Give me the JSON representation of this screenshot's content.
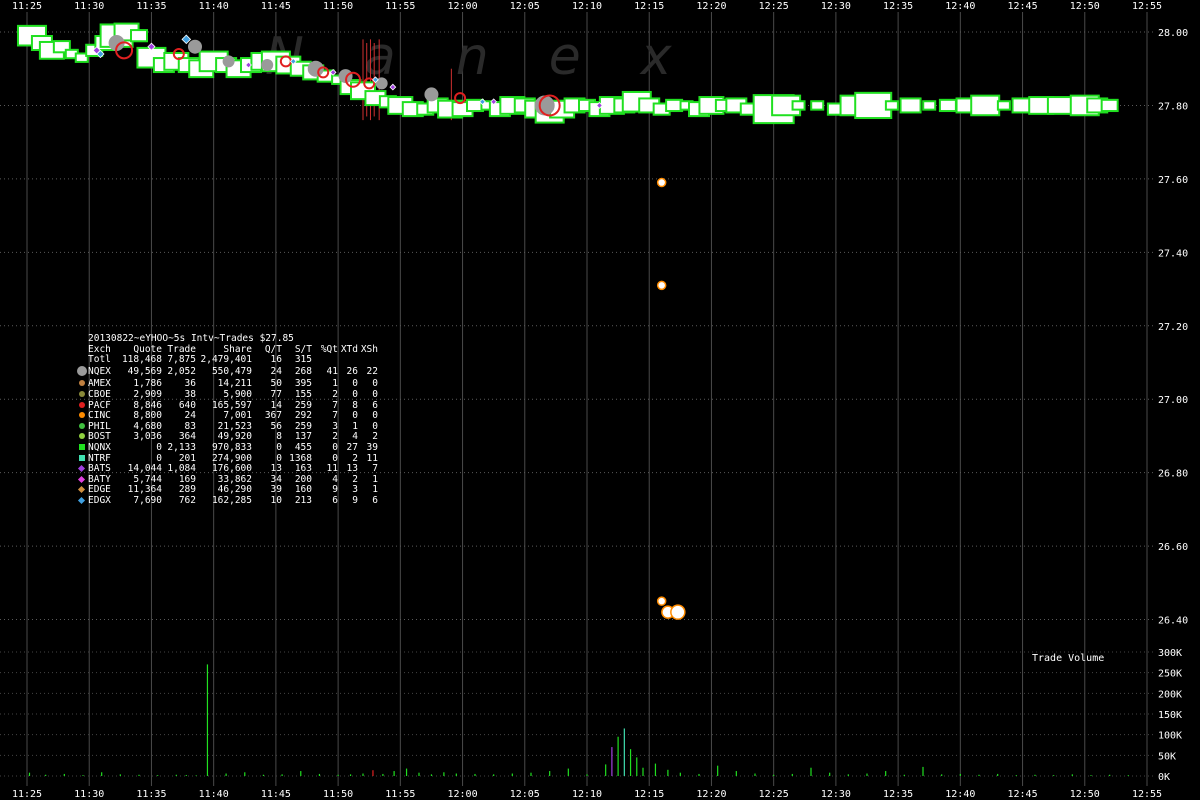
{
  "watermark": "Nanex",
  "stats_title": "20130822~eYHOO~5s Intv~Trades $27.85",
  "volume_label": "Trade Volume",
  "stats_columns": [
    "Exch",
    "Quote",
    "Trade",
    "Share",
    "Q/T",
    "S/T",
    "%Qt",
    "XTd",
    "XSh"
  ],
  "stats_rows": [
    {
      "exch": "Totl",
      "quote": "118,468",
      "trade": "7,875",
      "share": "2,479,401",
      "qt": "16",
      "st": "315",
      "pqt": "",
      "xtd": "",
      "xsh": "",
      "marker": "none",
      "color": ""
    },
    {
      "exch": "NQEX",
      "quote": "49,569",
      "trade": "2,052",
      "share": "550,479",
      "qt": "24",
      "st": "268",
      "pqt": "41",
      "xtd": "26",
      "xsh": "22",
      "marker": "bigdot",
      "color": "#9a9a9a"
    },
    {
      "exch": "AMEX",
      "quote": "1,786",
      "trade": "36",
      "share": "14,211",
      "qt": "50",
      "st": "395",
      "pqt": "1",
      "xtd": "0",
      "xsh": "0",
      "marker": "dot",
      "color": "#c08040"
    },
    {
      "exch": "CBOE",
      "quote": "2,909",
      "trade": "38",
      "share": "5,900",
      "qt": "77",
      "st": "155",
      "pqt": "2",
      "xtd": "0",
      "xsh": "0",
      "marker": "dot",
      "color": "#8a8a3a"
    },
    {
      "exch": "PACF",
      "quote": "8,846",
      "trade": "640",
      "share": "165,597",
      "qt": "14",
      "st": "259",
      "pqt": "7",
      "xtd": "8",
      "xsh": "6",
      "marker": "dot",
      "color": "#e02020"
    },
    {
      "exch": "CINC",
      "quote": "8,800",
      "trade": "24",
      "share": "7,001",
      "qt": "367",
      "st": "292",
      "pqt": "7",
      "xtd": "0",
      "xsh": "0",
      "marker": "dot",
      "color": "#ff8c00"
    },
    {
      "exch": "PHIL",
      "quote": "4,680",
      "trade": "83",
      "share": "21,523",
      "qt": "56",
      "st": "259",
      "pqt": "3",
      "xtd": "1",
      "xsh": "0",
      "marker": "dot",
      "color": "#40c040"
    },
    {
      "exch": "BOST",
      "quote": "3,036",
      "trade": "364",
      "share": "49,920",
      "qt": "8",
      "st": "137",
      "pqt": "2",
      "xtd": "4",
      "xsh": "2",
      "marker": "dot",
      "color": "#90d040"
    },
    {
      "exch": "NQNX",
      "quote": "0",
      "trade": "2,133",
      "share": "970,833",
      "qt": "0",
      "st": "455",
      "pqt": "0",
      "xtd": "27",
      "xsh": "39",
      "marker": "sq",
      "color": "#20e020"
    },
    {
      "exch": "NTRF",
      "quote": "0",
      "trade": "201",
      "share": "274,900",
      "qt": "0",
      "st": "1368",
      "pqt": "0",
      "xtd": "2",
      "xsh": "11",
      "marker": "sq",
      "color": "#40e0b0"
    },
    {
      "exch": "BATS",
      "quote": "14,044",
      "trade": "1,084",
      "share": "176,600",
      "qt": "13",
      "st": "163",
      "pqt": "11",
      "xtd": "13",
      "xsh": "7",
      "marker": "dia",
      "color": "#a040e0"
    },
    {
      "exch": "BATY",
      "quote": "5,744",
      "trade": "169",
      "share": "33,862",
      "qt": "34",
      "st": "200",
      "pqt": "4",
      "xtd": "2",
      "xsh": "1",
      "marker": "dia",
      "color": "#e040e0"
    },
    {
      "exch": "EDGE",
      "quote": "11,364",
      "trade": "289",
      "share": "46,290",
      "qt": "39",
      "st": "160",
      "pqt": "9",
      "xtd": "3",
      "xsh": "1",
      "marker": "dia",
      "color": "#d09040"
    },
    {
      "exch": "EDGX",
      "quote": "7,690",
      "trade": "762",
      "share": "162,285",
      "qt": "10",
      "st": "213",
      "pqt": "6",
      "xtd": "9",
      "xsh": "6",
      "marker": "dia",
      "color": "#40a0e0"
    }
  ],
  "chart_data": {
    "type": "scatter",
    "x_ticks": [
      "11:25",
      "11:30",
      "11:35",
      "11:40",
      "11:45",
      "11:50",
      "11:55",
      "12:00",
      "12:05",
      "12:10",
      "12:15",
      "12:20",
      "12:25",
      "12:30",
      "12:35",
      "12:40",
      "12:45",
      "12:50",
      "12:55"
    ],
    "xlim_minutes": [
      685,
      775
    ],
    "y_ticks": [
      "28.00",
      "27.80",
      "27.60",
      "27.40",
      "27.20",
      "27.00",
      "26.80",
      "26.60",
      "26.40"
    ],
    "ylim": [
      26.35,
      28.05
    ],
    "vol_ticks": [
      "300K",
      "250K",
      "200K",
      "150K",
      "100K",
      "50K",
      "0K"
    ],
    "vol_lim": [
      0,
      300000
    ],
    "grid": true,
    "trade_series": [
      {
        "name": "NQNX",
        "t": [
          685.4,
          686.2,
          687.0,
          687.8,
          688.6,
          689.4,
          690.4,
          691.3,
          692.2,
          693.0,
          694.0,
          695.0,
          696.0,
          697.0,
          698.0,
          699.0,
          700.0,
          701.0,
          702.0,
          703.0,
          704.0,
          705.0,
          706.0,
          707.0,
          708.0,
          709.0,
          710.0,
          711.0,
          712.0,
          713.0,
          714.0,
          715.0,
          716.0,
          717.0,
          718.0,
          719.0,
          720.0,
          721.0,
          722.0,
          723.0,
          724.0,
          725.0,
          726.0,
          727.0,
          728.0,
          729.0,
          730.0,
          731.0,
          732.0,
          733.0,
          734.0,
          735.0,
          736.0,
          737.0,
          738.0,
          739.0,
          740.0,
          741.0,
          742.0,
          743.0,
          744.0,
          745.0,
          746.0,
          747.0,
          748.5,
          750.0,
          751.5,
          753.0,
          754.5,
          756.0,
          757.5,
          759.0,
          760.5,
          762.0,
          763.5,
          765.0,
          766.5,
          768.0,
          770.0,
          771.0,
          772.0
        ],
        "y": [
          27.99,
          27.97,
          27.95,
          27.96,
          27.94,
          27.93,
          27.95,
          27.97,
          27.99,
          28.0,
          27.99,
          27.93,
          27.91,
          27.92,
          27.91,
          27.9,
          27.92,
          27.91,
          27.9,
          27.91,
          27.92,
          27.92,
          27.91,
          27.9,
          27.89,
          27.88,
          27.87,
          27.85,
          27.84,
          27.82,
          27.81,
          27.8,
          27.79,
          27.79,
          27.8,
          27.79,
          27.79,
          27.8,
          27.8,
          27.79,
          27.8,
          27.8,
          27.79,
          27.78,
          27.79,
          27.8,
          27.8,
          27.79,
          27.8,
          27.8,
          27.81,
          27.8,
          27.79,
          27.8,
          27.8,
          27.79,
          27.8,
          27.8,
          27.8,
          27.79,
          27.8,
          27.79,
          27.8,
          27.8,
          27.8,
          27.79,
          27.8,
          27.8,
          27.8,
          27.8,
          27.8,
          27.8,
          27.8,
          27.8,
          27.8,
          27.8,
          27.8,
          27.8,
          27.8,
          27.8,
          27.8
        ],
        "size": [
          14,
          10,
          12,
          8,
          6,
          6,
          8,
          10,
          16,
          12,
          8,
          14,
          10,
          12,
          10,
          12,
          14,
          10,
          12,
          10,
          12,
          14,
          12,
          10,
          10,
          8,
          6,
          10,
          12,
          10,
          8,
          12,
          10,
          8,
          10,
          12,
          10,
          8,
          6,
          10,
          12,
          10,
          12,
          14,
          12,
          10,
          8,
          10,
          12,
          10,
          14,
          10,
          8,
          8,
          6,
          10,
          12,
          8,
          10,
          8,
          6,
          20,
          14,
          6,
          6,
          8,
          14,
          18,
          6,
          10,
          6,
          8,
          10,
          14,
          6,
          10,
          12,
          12,
          14,
          10,
          8
        ],
        "color": "#20e020"
      },
      {
        "name": "NQEX",
        "t": [
          692.2,
          698.5,
          701.2,
          704.3,
          708.2,
          710.6,
          713.5,
          717.5,
          726.6
        ],
        "y": [
          27.97,
          27.96,
          27.92,
          27.91,
          27.9,
          27.88,
          27.86,
          27.83,
          27.8
        ],
        "size": [
          7,
          6,
          5,
          5,
          7,
          6,
          5,
          6,
          9
        ],
        "color": "#9a9a9a"
      },
      {
        "name": "PACF",
        "t": [
          692.8,
          697.2,
          705.8,
          708.8,
          711.2,
          712.5,
          719.8,
          727.0
        ],
        "y": [
          27.95,
          27.94,
          27.92,
          27.89,
          27.87,
          27.86,
          27.82,
          27.8
        ],
        "size": [
          8,
          5,
          5,
          5,
          7,
          5,
          5,
          10
        ],
        "color": "#e02020"
      },
      {
        "name": "BATS",
        "t": [
          690.6,
          695.0,
          702.8,
          709.6,
          714.4,
          722.5,
          731.0
        ],
        "y": [
          27.95,
          27.96,
          27.91,
          27.89,
          27.85,
          27.81,
          27.8
        ],
        "size": [
          5,
          5,
          4,
          4,
          4,
          4,
          4
        ],
        "color": "#a040e0"
      },
      {
        "name": "EDGX",
        "t": [
          690.9,
          697.8,
          706.4,
          713.0,
          721.6
        ],
        "y": [
          27.94,
          27.98,
          27.92,
          27.87,
          27.81
        ],
        "size": [
          5,
          6,
          4,
          4,
          4
        ],
        "color": "#40a0e0"
      },
      {
        "name": "CINC",
        "t": [
          736.0,
          736.0,
          736.0,
          736.5,
          737.3
        ],
        "y": [
          27.59,
          27.31,
          26.45,
          26.42,
          26.42
        ],
        "size": [
          4,
          4,
          4,
          6,
          7
        ],
        "color": "#ff8c00"
      }
    ],
    "price_spikes": [
      {
        "t": 712.0,
        "lo": 27.76,
        "hi": 27.98
      },
      {
        "t": 712.3,
        "lo": 27.77,
        "hi": 27.97
      },
      {
        "t": 712.6,
        "lo": 27.76,
        "hi": 27.98
      },
      {
        "t": 712.9,
        "lo": 27.77,
        "hi": 27.97
      },
      {
        "t": 713.3,
        "lo": 27.76,
        "hi": 27.98
      },
      {
        "t": 719.1,
        "lo": 27.76,
        "hi": 27.9
      }
    ],
    "volume_bars": {
      "t": [
        685.2,
        686.5,
        688.0,
        689.5,
        691.0,
        692.5,
        694.0,
        695.5,
        697.0,
        697.8,
        698.6,
        699.5,
        701.0,
        702.5,
        704.0,
        705.5,
        707.0,
        708.5,
        710.0,
        711.0,
        712.0,
        712.8,
        713.6,
        714.5,
        715.5,
        716.5,
        717.5,
        718.5,
        719.5,
        721.0,
        722.5,
        724.0,
        725.5,
        727.0,
        728.5,
        730.0,
        731.5,
        732.0,
        732.5,
        733.0,
        733.5,
        734.0,
        734.5,
        735.5,
        736.5,
        737.5,
        739.0,
        740.5,
        742.0,
        743.5,
        745.0,
        746.5,
        748.0,
        749.5,
        751.0,
        752.5,
        754.0,
        755.5,
        757.0,
        758.5,
        760.0,
        761.5,
        763.0,
        764.5,
        766.0,
        767.5,
        769.0,
        770.5,
        772.0,
        773.5
      ],
      "v": [
        8000,
        3000,
        5000,
        2000,
        9000,
        4000,
        3000,
        2000,
        3000,
        2500,
        1500,
        270000,
        6000,
        9000,
        3000,
        4000,
        12000,
        5000,
        3000,
        4000,
        6000,
        14000,
        5000,
        12000,
        18000,
        8000,
        4000,
        9000,
        6000,
        5000,
        4000,
        6000,
        8000,
        12000,
        18000,
        4000,
        28000,
        70000,
        95000,
        115000,
        65000,
        45000,
        20000,
        30000,
        15000,
        8000,
        5000,
        25000,
        12000,
        6000,
        3000,
        5000,
        20000,
        8000,
        4000,
        6000,
        12000,
        3000,
        22000,
        4000,
        5000,
        3000,
        5000,
        2000,
        3000,
        2000,
        4000,
        2000,
        3000,
        2000
      ],
      "color": [
        "#20e020",
        "#20e020",
        "#20e020",
        "#20e020",
        "#20e020",
        "#20e020",
        "#20e020",
        "#20e020",
        "#20e020",
        "#20e020",
        "#20e020",
        "#20e020",
        "#20e020",
        "#20e020",
        "#20e020",
        "#20e020",
        "#20e020",
        "#20e020",
        "#20e020",
        "#20e020",
        "#20e020",
        "#e02020",
        "#20e020",
        "#20e020",
        "#20e020",
        "#20e020",
        "#20e020",
        "#20e020",
        "#20e020",
        "#20e020",
        "#20e020",
        "#20e020",
        "#20e020",
        "#20e020",
        "#20e020",
        "#20e020",
        "#20e020",
        "#a040e0",
        "#20e020",
        "#40e0b0",
        "#20e020",
        "#20e020",
        "#20e020",
        "#20e020",
        "#20e020",
        "#20e020",
        "#20e020",
        "#20e020",
        "#20e020",
        "#20e020",
        "#20e020",
        "#20e020",
        "#20e020",
        "#20e020",
        "#20e020",
        "#20e020",
        "#20e020",
        "#20e020",
        "#20e020",
        "#20e020",
        "#20e020",
        "#20e020",
        "#20e020",
        "#20e020",
        "#20e020",
        "#20e020",
        "#20e020",
        "#20e020",
        "#20e020",
        "#20e020"
      ]
    }
  }
}
